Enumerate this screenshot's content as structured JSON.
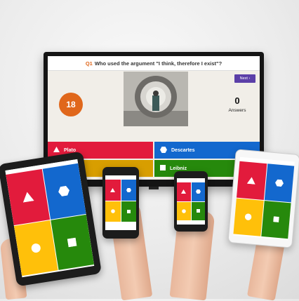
{
  "tv": {
    "question_number": "Q1",
    "question_text": "Who used the argument \"I think, therefore I exist\"?",
    "next_label": "Next ›",
    "timer": "18",
    "answers_count": "0",
    "answers_label": "Answers",
    "answers": [
      {
        "label": "Plato",
        "shape": "triangle",
        "color": "#e21b3c"
      },
      {
        "label": "Descartes",
        "shape": "hexagon",
        "color": "#1368ce"
      },
      {
        "label": "",
        "shape": "circle",
        "color": "#d89e00"
      },
      {
        "label": "Leibniz",
        "shape": "square",
        "color": "#26890c"
      }
    ]
  },
  "devices": {
    "tablet_left": {
      "shapes": [
        "triangle-icon",
        "hexagon-icon",
        "circle-icon",
        "square-icon"
      ]
    },
    "phone_center": {
      "shapes": [
        "triangle-icon",
        "hexagon-icon",
        "circle-icon",
        "square-icon"
      ]
    },
    "phone_right": {
      "shapes": [
        "triangle-icon",
        "hexagon-icon",
        "circle-icon",
        "square-icon"
      ]
    },
    "tablet_right": {
      "shapes": [
        "triangle-icon",
        "hexagon-icon",
        "circle-icon",
        "square-icon"
      ]
    }
  },
  "colors": {
    "red": "#e21b3c",
    "blue": "#1368ce",
    "yellow": "#ffc00a",
    "green": "#26890c",
    "orange": "#e0671b",
    "purple": "#5b3fa8"
  }
}
